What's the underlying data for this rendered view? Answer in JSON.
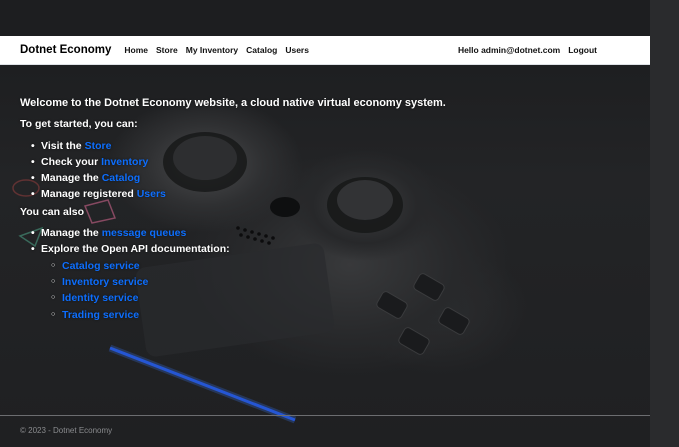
{
  "navbar": {
    "brand": "Dotnet Economy",
    "links": [
      "Home",
      "Store",
      "My Inventory",
      "Catalog",
      "Users"
    ],
    "greeting": "Hello admin@dotnet.com",
    "logout": "Logout"
  },
  "main": {
    "heading": "Welcome to the Dotnet Economy website, a cloud native virtual economy system.",
    "intro": "To get started, you can:",
    "steps": [
      {
        "prefix": "Visit the ",
        "link": "Store"
      },
      {
        "prefix": "Check your ",
        "link": "Inventory"
      },
      {
        "prefix": "Manage the ",
        "link": "Catalog"
      },
      {
        "prefix": "Manage registered ",
        "link": "Users"
      }
    ],
    "also": "You can also",
    "extras": {
      "queues_prefix": "Manage the ",
      "queues_link": "message queues",
      "api_label": "Explore the Open API documentation:",
      "services": [
        "Catalog service",
        "Inventory service",
        "Identity service",
        "Trading service"
      ]
    }
  },
  "footer": {
    "text": "© 2023 - Dotnet Economy"
  },
  "colors": {
    "link": "#0d6efd",
    "navbar_bg": "#ffffff",
    "page_bg": "#1c1d1f"
  }
}
